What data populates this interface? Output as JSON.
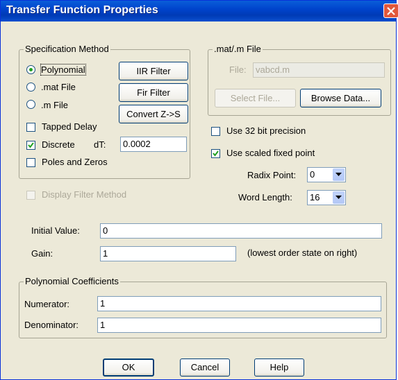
{
  "window": {
    "title": "Transfer Function Properties"
  },
  "spec_method": {
    "legend": "Specification Method",
    "options": [
      {
        "label": "Polynomial",
        "selected": true
      },
      {
        "label": ".mat File",
        "selected": false
      },
      {
        "label": ".m File",
        "selected": false
      }
    ],
    "buttons": {
      "iir": "IIR Filter",
      "fir": "Fir Filter",
      "convert": "Convert Z->S"
    },
    "tapped_delay": {
      "label": "Tapped Delay",
      "checked": false
    },
    "discrete": {
      "label": "Discrete",
      "checked": true
    },
    "dt_label": "dT:",
    "dt_value": "0.0002",
    "poles_zeros": {
      "label": "Poles and Zeros",
      "checked": false
    }
  },
  "mat_file": {
    "legend": ".mat/.m File",
    "file_label": "File:",
    "file_value": "vabcd.m",
    "select_file": "Select File...",
    "browse_data": "Browse Data..."
  },
  "display_filter_method": {
    "label": "Display Filter Method",
    "checked": false,
    "enabled": false
  },
  "precision": {
    "use32": {
      "label": "Use 32 bit precision",
      "checked": false
    },
    "scaled": {
      "label": "Use scaled fixed point",
      "checked": true
    },
    "radix_label": "Radix Point:",
    "radix_value": "0",
    "word_label": "Word Length:",
    "word_value": "16"
  },
  "initial_value": {
    "label": "Initial Value:",
    "value": "0"
  },
  "gain": {
    "label": "Gain:",
    "value": "1"
  },
  "order_note": "(lowest order state on right)",
  "poly_coeffs": {
    "legend": "Polynomial Coefficients",
    "numerator_label": "Numerator:",
    "numerator_value": "1",
    "denominator_label": "Denominator:",
    "denominator_value": "1"
  },
  "footer": {
    "ok": "OK",
    "cancel": "Cancel",
    "help": "Help"
  },
  "colors": {
    "title_bar": "#0054e3",
    "face": "#ece9d8",
    "close": "#e2583b"
  }
}
